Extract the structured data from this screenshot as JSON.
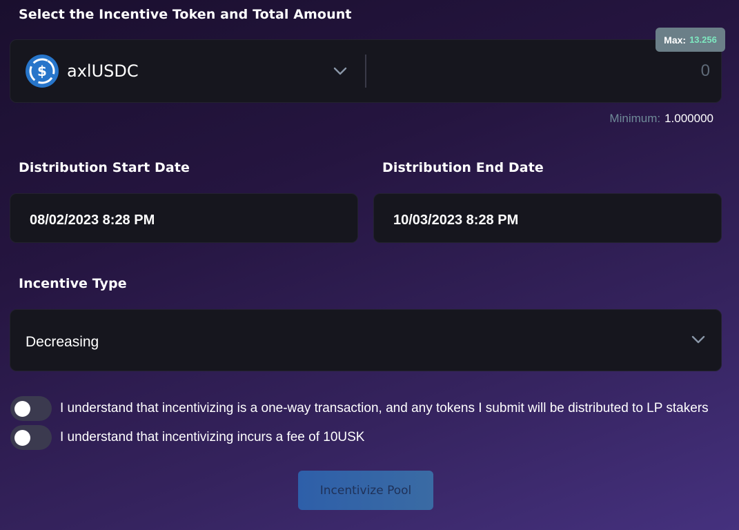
{
  "token_section": {
    "title": "Select the Incentive Token and Total Amount",
    "token_name": "axlUSDC",
    "token_icon": "usdc-icon",
    "amount_value": "0",
    "max_label": "Max:",
    "max_value": "13.256",
    "minimum_label": "Minimum:",
    "minimum_value": "1.000000"
  },
  "dates": {
    "start_label": "Distribution Start Date",
    "start_value": "08/02/2023 8:28 PM",
    "end_label": "Distribution End Date",
    "end_value": "10/03/2023 8:28 PM"
  },
  "incentive_type": {
    "label": "Incentive Type",
    "selected": "Decreasing"
  },
  "agreements": [
    {
      "text": "I understand that incentivizing is a one-way transaction, and any tokens I submit will be distributed to LP stakers",
      "checked": false
    },
    {
      "text": "I understand that incentivizing incurs a fee of 10USK",
      "checked": false
    }
  ],
  "submit_label": "Incentivize Pool",
  "colors": {
    "accent_teal": "#7ee8c0",
    "usdc_blue": "#2775ca",
    "button_blue": "#2e63ad"
  }
}
